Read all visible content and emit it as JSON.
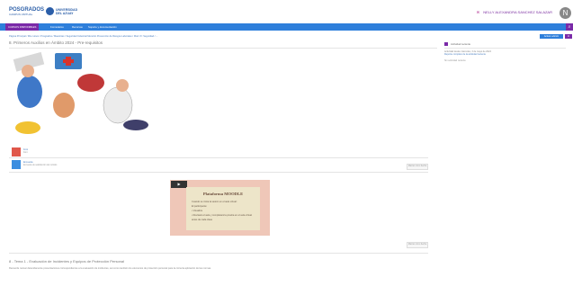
{
  "header": {
    "logo_posgrados": "POSGRADOS",
    "logo_posgrados_sub": "CAMPUS VIRTUAL",
    "logo_university_line1": "UNIVERSIDAD",
    "logo_university_line2": "DEL AZUAY",
    "user_name": "NELLY ALEXANDRA SANCHEZ SALAZAR",
    "avatar_initial": "N"
  },
  "nav": {
    "items": [
      "CURSOS DISPONIBLES",
      "Formularios",
      "Recursos",
      "Soporte y documentación"
    ]
  },
  "breadcrumb": "Página Principal / Mis cursos / Posgrados / Maestrías / Seguridad Industrial Mención Prevención de Riesgos Laborales / Mod. IX: Seguridad / ...",
  "page_title": "8. Primeros Auxilios en Ámbito 2024 - Pre-requisitos",
  "right_button": "Activar edición",
  "sidebar": {
    "heading": "Actividad reciente",
    "text": "Actividad desde miércoles, 3 de mayo de 2024",
    "link": "Reporte completo de la actividad reciente",
    "empty": "Sin actividad reciente"
  },
  "activities": [
    {
      "label": "Foro",
      "sub": "Foro"
    },
    {
      "label": "Encuesta",
      "sub": "Encuesta de satisfacción del módulo"
    }
  ],
  "buttons": {
    "mark_done_1": "Marcar como hecha",
    "mark_done_2": "Marcar como hecha"
  },
  "video": {
    "title": "Plataforma MOODLE",
    "line1": "Cuando se inicia la sesión en el aula virtual:",
    "line2": "El participante:",
    "line3": "• Visualiza",
    "line4": "• Revisará el aula y completará la prueba en el aula virtual",
    "line5": "  antes de cada clase",
    "play_label": "▶"
  },
  "topic": {
    "title": "8 - Tema 1 - Evaluación de Incidentes y Equipos de Protección Personal",
    "desc": "Recuerde revisar detenidamente presentaciones correspondientes a la evaluación de incidentes, así como también los elementos de protección personal para la correcta aplicación de las normas."
  },
  "colors": {
    "nav": "#2e7fdb",
    "accent": "#7a2aa8"
  }
}
